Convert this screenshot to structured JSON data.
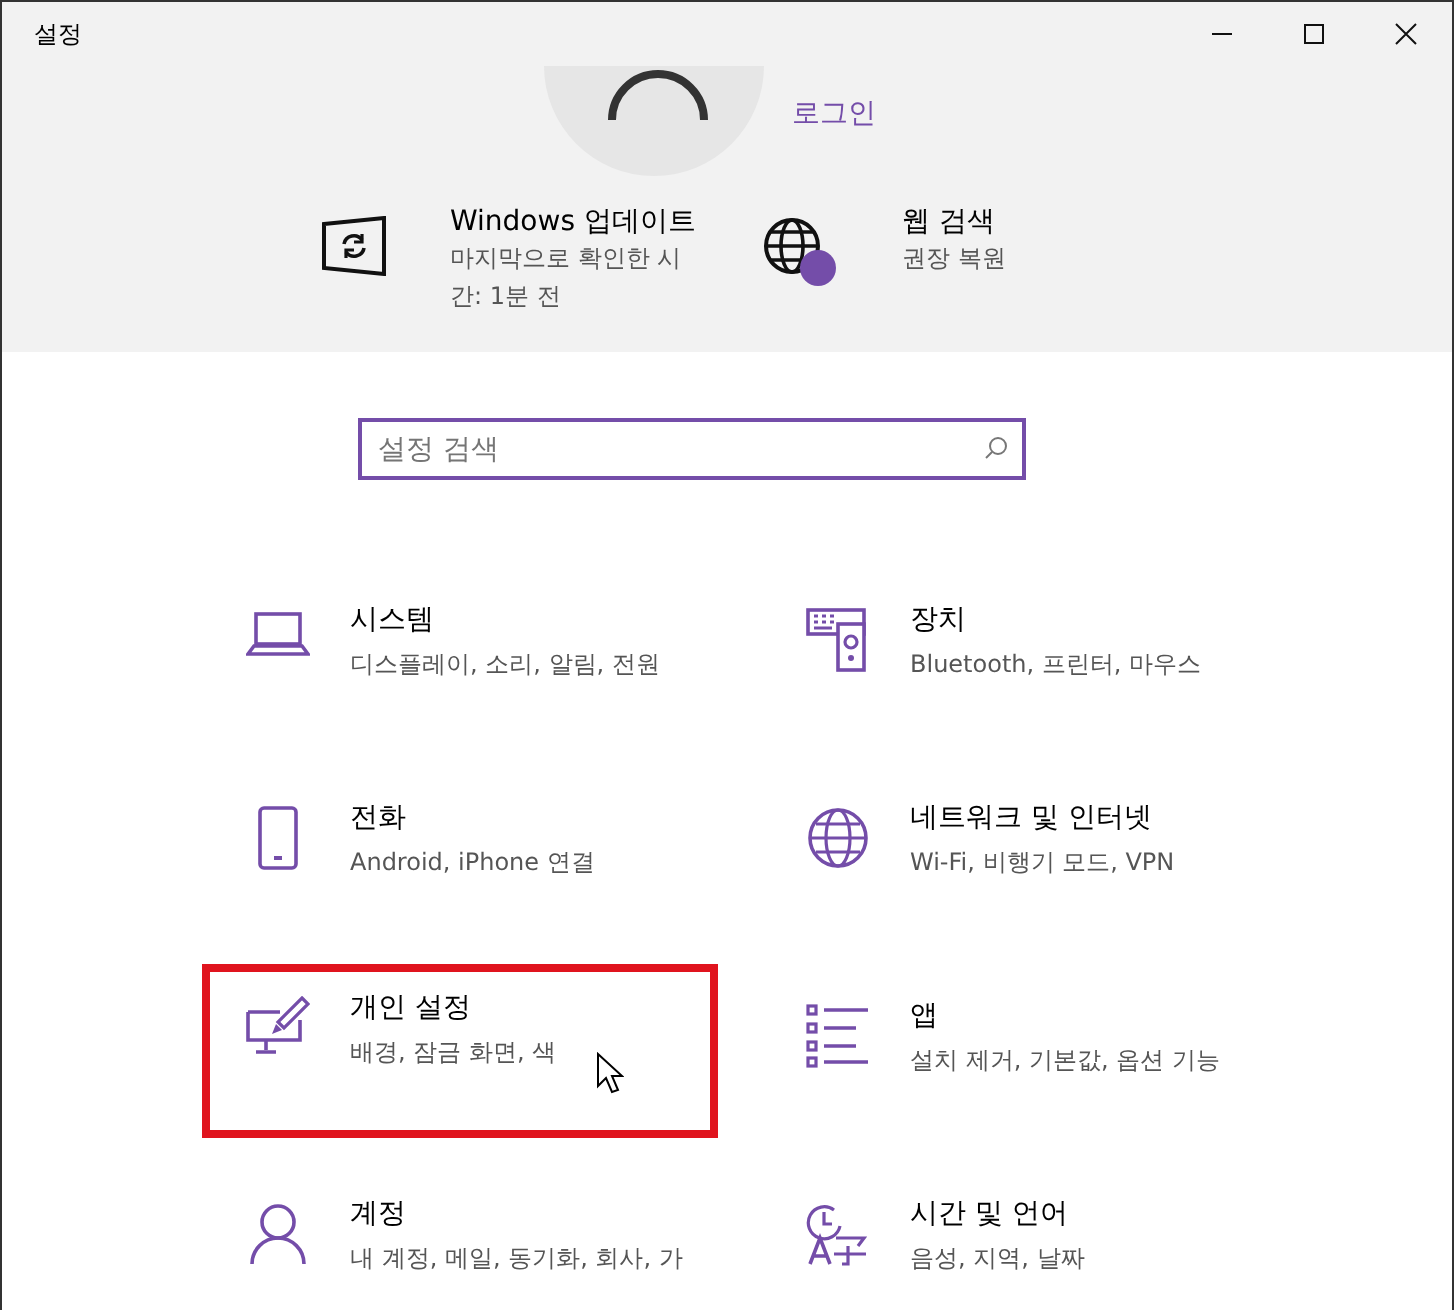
{
  "window": {
    "title": "설정"
  },
  "account": {
    "link": "로그인"
  },
  "quick_links": [
    {
      "kind": "update",
      "title": "Windows 업데이트",
      "subtitle": "마지막으로 확인한 시간: 1분 전"
    },
    {
      "kind": "web",
      "title": "웹 검색",
      "subtitle": "권장 복원"
    }
  ],
  "search": {
    "placeholder": "설정 검색"
  },
  "tiles": [
    {
      "kind": "system",
      "title": "시스템",
      "subtitle": "디스플레이, 소리, 알림, 전원",
      "highlighted": false
    },
    {
      "kind": "devices",
      "title": "장치",
      "subtitle": "Bluetooth, 프린터, 마우스",
      "highlighted": false
    },
    {
      "kind": "phone",
      "title": "전화",
      "subtitle": "Android, iPhone 연결",
      "highlighted": false
    },
    {
      "kind": "network",
      "title": "네트워크 및 인터넷",
      "subtitle": "Wi-Fi, 비행기 모드, VPN",
      "highlighted": false
    },
    {
      "kind": "personal",
      "title": "개인 설정",
      "subtitle": "배경, 잠금 화면, 색",
      "highlighted": true
    },
    {
      "kind": "apps",
      "title": "앱",
      "subtitle": "설치 제거, 기본값, 옵션 기능",
      "highlighted": false
    },
    {
      "kind": "accounts",
      "title": "계정",
      "subtitle": "내 계정, 메일, 동기화, 회사, 가",
      "highlighted": false
    },
    {
      "kind": "time",
      "title": "시간 및 언어",
      "subtitle": "음성, 지역, 날짜",
      "highlighted": false
    }
  ]
}
